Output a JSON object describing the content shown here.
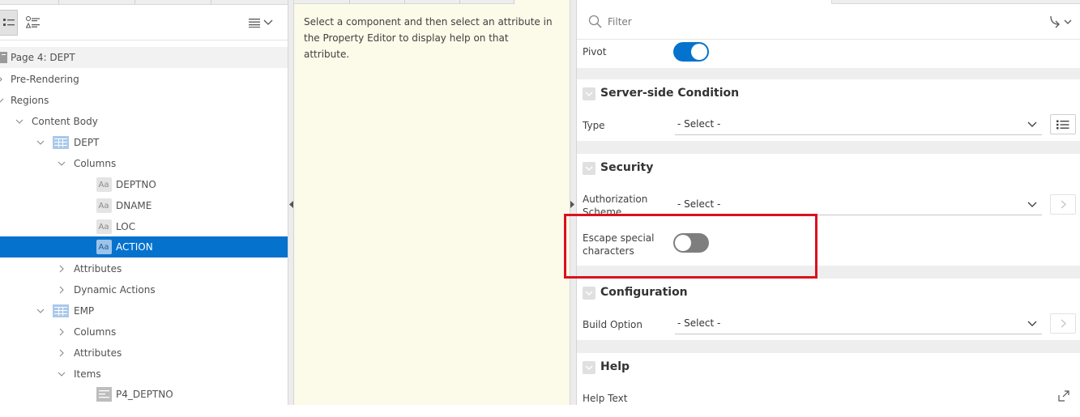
{
  "tree": {
    "page_title": "Page 4: DEPT",
    "nodes": [
      {
        "label": "Pre-Rendering"
      },
      {
        "label": "Regions"
      },
      {
        "label": "Content Body"
      },
      {
        "label": "DEPT"
      },
      {
        "label": "Columns"
      },
      {
        "label": "DEPTNO",
        "icon": "Aa"
      },
      {
        "label": "DNAME",
        "icon": "Aa"
      },
      {
        "label": "LOC",
        "icon": "Aa"
      },
      {
        "label": "ACTION",
        "icon": "Aa"
      },
      {
        "label": "Attributes"
      },
      {
        "label": "Dynamic Actions"
      },
      {
        "label": "EMP"
      },
      {
        "label": "Columns"
      },
      {
        "label": "Attributes"
      },
      {
        "label": "Items"
      },
      {
        "label": "P4_DEPTNO"
      }
    ]
  },
  "help": {
    "text": "Select a component and then select an attribute in the Property Editor to display help on that attribute."
  },
  "property_editor": {
    "filter_placeholder": "Filter",
    "pivot": {
      "label": "Pivot",
      "value": true
    },
    "server_side_condition": {
      "title": "Server-side Condition",
      "type_label": "Type",
      "type_value": "- Select -"
    },
    "security": {
      "title": "Security",
      "auth_label": "Authorization Scheme",
      "auth_value": "- Select -",
      "escape_label": "Escape special characters",
      "escape_value": false
    },
    "configuration": {
      "title": "Configuration",
      "build_label": "Build Option",
      "build_value": "- Select -"
    },
    "help_group": {
      "title": "Help",
      "help_text_label": "Help Text"
    }
  },
  "colors": {
    "selected_row": "#0572ce",
    "toggle_on": "#0572ce",
    "toggle_off": "#7e7e7e",
    "highlight": "#d9121f",
    "help_bg": "#fcfae8"
  }
}
